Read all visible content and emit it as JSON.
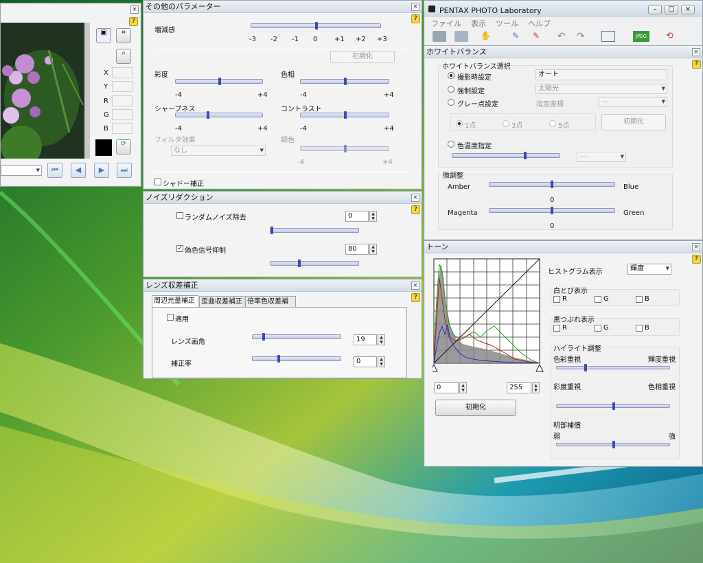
{
  "colors": {
    "accent": "#3b48b8",
    "title_bar": "#d5dde6",
    "help": "#f2d64a"
  },
  "viewer": {
    "x_label": "X",
    "y_label": "Y",
    "r_label": "R",
    "g_label": "G",
    "b_label": "B",
    "icons": [
      "print-icon",
      "crop-icon",
      "zoom-icon",
      "refresh-icon"
    ],
    "nav_icons": [
      "first-icon",
      "prev-icon",
      "next-icon",
      "last-icon"
    ]
  },
  "other_params": {
    "title": "その他のパラメーター",
    "gain_label": "増減感",
    "gain_ticks": [
      "-3",
      "-2",
      "-1",
      "0",
      "+1",
      "+2",
      "+3"
    ],
    "gain_value": 0,
    "reset": "初期化",
    "saturation": "彩度",
    "hue": "色相",
    "sharpness": "シャープネス",
    "contrast": "コントラスト",
    "min": "-4",
    "max": "+4",
    "filter_label": "フィルタ効果",
    "filter_value": "なし",
    "tone_label": "調色",
    "shadow_label": "シャドー補正"
  },
  "noise": {
    "title": "ノイズリダクション",
    "random_label": "ランダムノイズ除去",
    "random_value": "0",
    "random_checked": false,
    "false_color_label": "偽色信号抑制",
    "false_color_value": "80",
    "false_color_checked": true
  },
  "lens": {
    "title": "レンズ収差補正",
    "tabs": [
      "周辺光量補正",
      "歪曲収差補正",
      "倍率色収差補正"
    ],
    "apply_label": "適用",
    "angle_label": "レンズ画角",
    "angle_value": "19",
    "rate_label": "補正率",
    "rate_value": "0"
  },
  "main_window": {
    "title": "PENTAX PHOTO Laboratory",
    "menu": [
      "ファイル",
      "表示",
      "ツール",
      "ヘルプ"
    ],
    "jpeg_label": "JPEG"
  },
  "wb": {
    "title": "ホワイトバランス",
    "select_label": "ホワイトバランス選択",
    "opt_shoot": "撮影時設定",
    "opt_shoot_value": "オート",
    "opt_force": "強制設定",
    "opt_force_value": "太陽光",
    "opt_gray": "グレー点設定",
    "coord_label": "指定座標",
    "coord_value": "---",
    "pt1": "1点",
    "pt3": "3点",
    "pt5": "5点",
    "reset": "初期化",
    "temp_label": "色温度指定",
    "temp_value": "---",
    "fine_label": "微調整",
    "amber": "Amber",
    "blue": "Blue",
    "ab_value": "0",
    "magenta": "Magenta",
    "green": "Green",
    "mg_value": "0"
  },
  "tone": {
    "title": "トーン",
    "histo_label": "ヒストグラム表示",
    "histo_value": "輝度",
    "highlight_label": "白とび表示",
    "shadow_label": "黒つぶれ表示",
    "r": "R",
    "g": "G",
    "b": "B",
    "adjust_label": "ハイライト調整",
    "color_pri": "色彩重視",
    "lum_pri": "輝度重視",
    "sat_pri": "彩度重視",
    "hue_pri": "色相重視",
    "bright_label": "明部補償",
    "weak": "弱",
    "strong": "強",
    "low_value": "0",
    "high_value": "255",
    "reset": "初期化"
  }
}
